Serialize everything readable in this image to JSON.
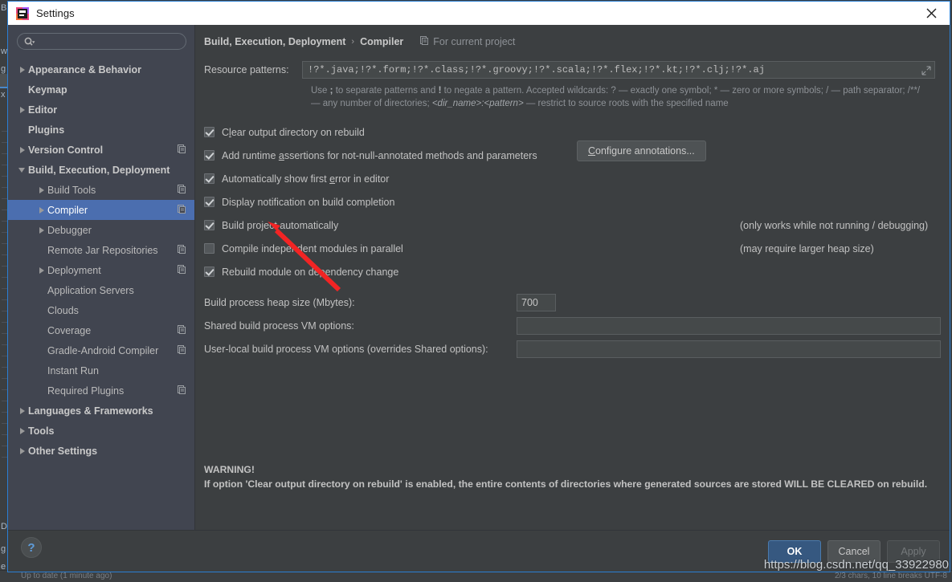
{
  "window": {
    "title": "Settings",
    "close_label": "×",
    "app_icon": "intellij-idea-icon"
  },
  "sidebar": {
    "search": {
      "value": "",
      "placeholder": ""
    },
    "items": [
      {
        "label": "Appearance & Behavior",
        "arrow": "right",
        "level": 0,
        "bold": true,
        "selected": false,
        "project_icon": false
      },
      {
        "label": "Keymap",
        "arrow": "none",
        "level": 0,
        "bold": true,
        "selected": false,
        "project_icon": false
      },
      {
        "label": "Editor",
        "arrow": "right",
        "level": 0,
        "bold": true,
        "selected": false,
        "project_icon": false
      },
      {
        "label": "Plugins",
        "arrow": "none",
        "level": 0,
        "bold": true,
        "selected": false,
        "project_icon": false
      },
      {
        "label": "Version Control",
        "arrow": "right",
        "level": 0,
        "bold": true,
        "selected": false,
        "project_icon": true
      },
      {
        "label": "Build, Execution, Deployment",
        "arrow": "down",
        "level": 0,
        "bold": true,
        "selected": false,
        "project_icon": false
      },
      {
        "label": "Build Tools",
        "arrow": "right",
        "level": 1,
        "bold": false,
        "selected": false,
        "project_icon": true
      },
      {
        "label": "Compiler",
        "arrow": "right",
        "level": 1,
        "bold": false,
        "selected": true,
        "project_icon": true
      },
      {
        "label": "Debugger",
        "arrow": "right",
        "level": 1,
        "bold": false,
        "selected": false,
        "project_icon": false
      },
      {
        "label": "Remote Jar Repositories",
        "arrow": "none",
        "level": 1,
        "bold": false,
        "selected": false,
        "project_icon": true
      },
      {
        "label": "Deployment",
        "arrow": "right",
        "level": 1,
        "bold": false,
        "selected": false,
        "project_icon": true
      },
      {
        "label": "Application Servers",
        "arrow": "none",
        "level": 1,
        "bold": false,
        "selected": false,
        "project_icon": false
      },
      {
        "label": "Clouds",
        "arrow": "none",
        "level": 1,
        "bold": false,
        "selected": false,
        "project_icon": false
      },
      {
        "label": "Coverage",
        "arrow": "none",
        "level": 1,
        "bold": false,
        "selected": false,
        "project_icon": true
      },
      {
        "label": "Gradle-Android Compiler",
        "arrow": "none",
        "level": 1,
        "bold": false,
        "selected": false,
        "project_icon": true
      },
      {
        "label": "Instant Run",
        "arrow": "none",
        "level": 1,
        "bold": false,
        "selected": false,
        "project_icon": false
      },
      {
        "label": "Required Plugins",
        "arrow": "none",
        "level": 1,
        "bold": false,
        "selected": false,
        "project_icon": true
      },
      {
        "label": "Languages & Frameworks",
        "arrow": "right",
        "level": 0,
        "bold": true,
        "selected": false,
        "project_icon": false
      },
      {
        "label": "Tools",
        "arrow": "right",
        "level": 0,
        "bold": true,
        "selected": false,
        "project_icon": false
      },
      {
        "label": "Other Settings",
        "arrow": "right",
        "level": 0,
        "bold": true,
        "selected": false,
        "project_icon": false
      }
    ]
  },
  "main": {
    "breadcrumb": {
      "parent": "Build, Execution, Deployment",
      "separator": "›",
      "current": "Compiler",
      "scope_label": "For current project",
      "scope_icon": "project-scope-icon"
    },
    "resource_patterns": {
      "label": "Resource patterns:",
      "value": "!?*.java;!?*.form;!?*.class;!?*.groovy;!?*.scala;!?*.flex;!?*.kt;!?*.clj;!?*.aj",
      "expand_icon": "expand-editor-icon"
    },
    "hint_line1_a": "Use ",
    "hint_line1_semicolon": ";",
    "hint_line1_b": " to separate patterns and ",
    "hint_line1_bang": "!",
    "hint_line1_c": " to negate a pattern. Accepted wildcards: ? — exactly one symbol; * — zero or more symbols; / — path separator; /**/",
    "hint_line2_a": "— any number of directories;  ",
    "hint_line2_italic1": "<dir_name>",
    "hint_line2_colon": ":",
    "hint_line2_italic2": "<pattern>",
    "hint_line2_b": " — restrict to source roots with the specified name",
    "checkboxes": [
      {
        "label_pre": "C",
        "label_u": "l",
        "label_post": "ear output directory on rebuild",
        "checked": true,
        "note": ""
      },
      {
        "label_pre": "Add runtime ",
        "label_u": "a",
        "label_post": "ssertions for not-null-annotated methods and parameters",
        "checked": true,
        "note": ""
      },
      {
        "label_pre": "Automatically show first ",
        "label_u": "e",
        "label_post": "rror in editor",
        "checked": true,
        "note": ""
      },
      {
        "label_pre": "Display notification on build completion",
        "label_u": "",
        "label_post": "",
        "checked": true,
        "note": ""
      },
      {
        "label_pre": "Build project automatically",
        "label_u": "",
        "label_post": "",
        "checked": true,
        "note": "(only works while not running / debugging)"
      },
      {
        "label_pre": "Compile independent modules in parallel",
        "label_u": "",
        "label_post": "",
        "checked": false,
        "note": "(may require larger heap size)"
      },
      {
        "label_pre": "Rebuild module on dependency change",
        "label_u": "",
        "label_post": "",
        "checked": true,
        "note": ""
      }
    ],
    "configure_annotations": {
      "pre": "",
      "u": "C",
      "post": "onfigure annotations..."
    },
    "fields": [
      {
        "label": "Build process heap size (Mbytes):",
        "value": "700",
        "kind": "heap"
      },
      {
        "label": "Shared build process VM options:",
        "value": "",
        "kind": "vm"
      },
      {
        "label": "User-local build process VM options (overrides Shared options):",
        "value": "",
        "kind": "vm"
      }
    ],
    "warning_title": "WARNING!",
    "warning_body": "If option 'Clear output directory on rebuild' is enabled, the entire contents of directories where generated sources are stored WILL BE CLEARED on rebuild."
  },
  "footer": {
    "help_label": "?",
    "ok_label": "OK",
    "cancel_label": "Cancel",
    "apply_label": "Apply"
  },
  "watermark": "https://blog.csdn.net/qq_33922980",
  "background": {
    "letters": [
      "B",
      "w",
      "g",
      "x",
      "D",
      "g",
      "e"
    ],
    "status_left": "Up to date (1 minute ago)",
    "status_right": "2/3 chars, 10 line breaks     UTF-8"
  },
  "colors": {
    "accent_blue": "#2a7fd4",
    "selection_blue": "#4b6eaf",
    "ok_button": "#365880",
    "panel_bg": "#3c3f41",
    "sidebar_bg": "#414550",
    "arrow_red": "#f22424"
  }
}
